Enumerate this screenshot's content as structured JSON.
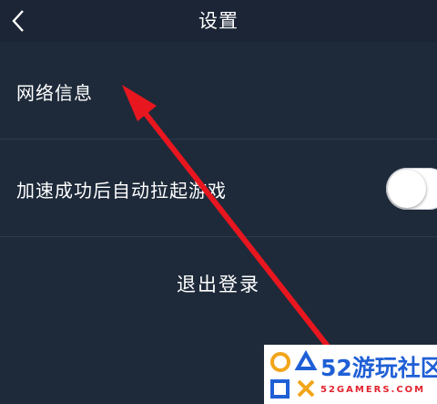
{
  "header": {
    "title": "设置",
    "back_icon": "back-chevron-icon"
  },
  "settings": {
    "network_info_label": "网络信息",
    "auto_launch_label": "加速成功后自动拉起游戏",
    "auto_launch_toggle": false,
    "logout_label": "退出登录"
  },
  "watermark": {
    "brand_number": "52",
    "brand_name": "游玩社区",
    "domain": "52GAMERS.COM"
  },
  "colors": {
    "background": "#1e2a3a",
    "header": "#1b2535",
    "arrow": "#e8161f",
    "text": "#ffffff"
  }
}
